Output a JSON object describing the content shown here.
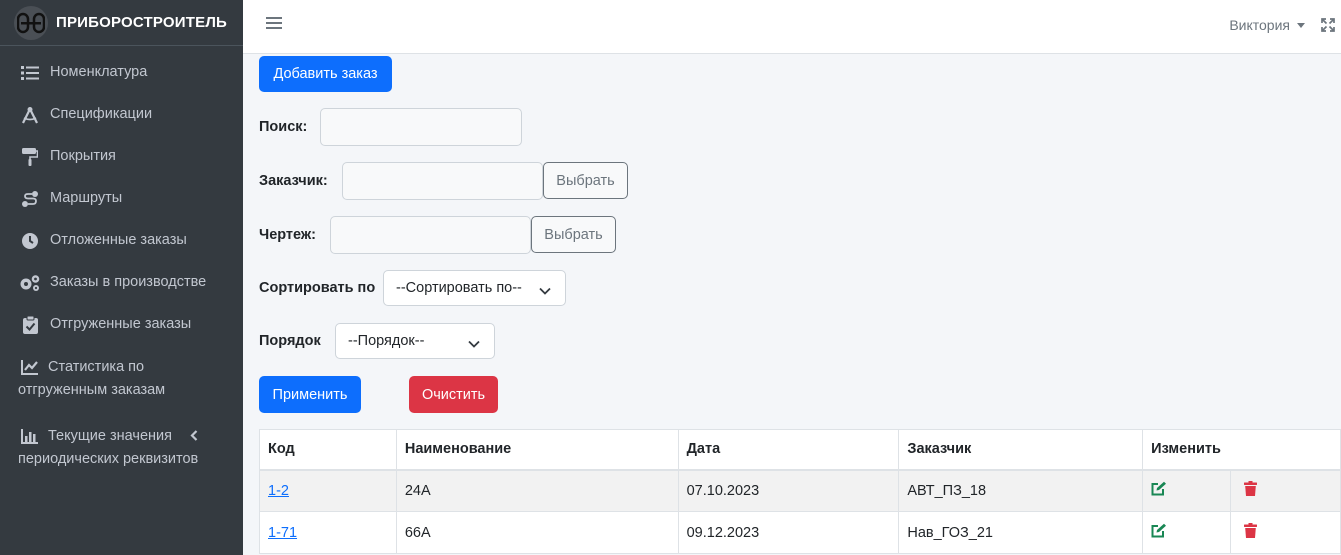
{
  "brand": {
    "name": "ПРИБОРОСТРОИТЕЛЬ",
    "logo_icon": "brand-logo-icon"
  },
  "sidebar": {
    "items": [
      {
        "label": "Номенклатура",
        "icon": "list-icon"
      },
      {
        "label": "Спецификации",
        "icon": "compass-icon"
      },
      {
        "label": "Покрытия",
        "icon": "paint-roller-icon"
      },
      {
        "label": "Маршруты",
        "icon": "route-icon"
      },
      {
        "label": "Отложенные заказы",
        "icon": "clock-icon"
      },
      {
        "label": "Заказы в производстве",
        "icon": "gears-icon"
      },
      {
        "label": "Отгруженные заказы",
        "icon": "clipboard-check-icon"
      },
      {
        "label": "Статистика по отгруженным заказам",
        "icon": "chart-line-icon"
      },
      {
        "label": "Текущие значения периодических реквизитов",
        "icon": "chart-bar-icon"
      }
    ]
  },
  "header": {
    "user_name": "Виктория"
  },
  "main": {
    "add_order_label": "Добавить заказ",
    "search_label": "Поиск:",
    "customer_label": "Заказчик:",
    "customer_select_button": "Выбрать",
    "drawing_label": "Чертеж:",
    "drawing_select_button": "Выбрать",
    "sort_label": "Сортировать по",
    "sort_selected": "--Сортировать по--",
    "order_label": "Порядок",
    "order_selected": "--Порядок--",
    "apply_label": "Применить",
    "clear_label": "Очистить"
  },
  "table": {
    "headers": {
      "code": "Код",
      "name": "Наименование",
      "date": "Дата",
      "customer": "Заказчик",
      "edit": "Изменить"
    },
    "rows": [
      {
        "code": "1-2",
        "name": "24А",
        "date": "07.10.2023",
        "customer": "АВТ_ПЗ_18"
      },
      {
        "code": "1-71",
        "name": "66А",
        "date": "09.12.2023",
        "customer": "Нав_ГОЗ_21"
      }
    ]
  },
  "colors": {
    "sidebar_bg": "#343a40",
    "primary": "#0d6efd",
    "danger": "#dc3545",
    "edit_green": "#198754",
    "delete_red": "#dc3545"
  }
}
